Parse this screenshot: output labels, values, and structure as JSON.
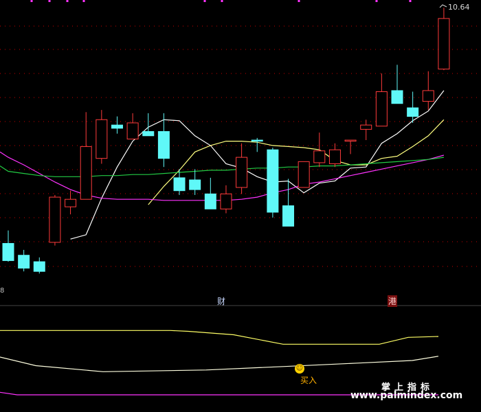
{
  "chart_data": {
    "type": "candlestick",
    "price_label": "10.64",
    "left_edge_label": "8",
    "markers": {
      "cai": "财",
      "gang": "港",
      "buy": "买入"
    },
    "brand": {
      "cn": "掌上指标",
      "url": "www.palmindex.com"
    },
    "colors": {
      "up": "#ff3b3b",
      "down": "#5ff8f8",
      "ma5": "#ffffff",
      "ma10": "#ffff80",
      "ma20": "#ff33ff",
      "ma60": "#22cc44",
      "grid": "#cc0000",
      "ind_yellow": "#ffff66",
      "ind_white": "#ffffe0",
      "ind_magenta": "#ff33ff"
    },
    "price_axis_range": [
      8.0,
      10.68
    ],
    "candles": [
      {
        "o": 8.45,
        "h": 8.57,
        "l": 8.28,
        "c": 8.29
      },
      {
        "o": 8.34,
        "h": 8.39,
        "l": 8.19,
        "c": 8.22
      },
      {
        "o": 8.28,
        "h": 8.32,
        "l": 8.17,
        "c": 8.19
      },
      {
        "o": 8.46,
        "h": 8.9,
        "l": 8.43,
        "c": 8.88
      },
      {
        "o": 8.79,
        "h": 8.94,
        "l": 8.72,
        "c": 8.86
      },
      {
        "o": 8.86,
        "h": 9.67,
        "l": 8.86,
        "c": 9.35
      },
      {
        "o": 9.24,
        "h": 9.69,
        "l": 9.19,
        "c": 9.6
      },
      {
        "o": 9.55,
        "h": 9.63,
        "l": 9.47,
        "c": 9.52
      },
      {
        "o": 9.42,
        "h": 9.66,
        "l": 9.42,
        "c": 9.57
      },
      {
        "o": 9.49,
        "h": 9.66,
        "l": 9.46,
        "c": 9.45
      },
      {
        "o": 9.49,
        "h": 9.66,
        "l": 9.16,
        "c": 9.24
      },
      {
        "o": 9.06,
        "h": 9.14,
        "l": 8.9,
        "c": 8.94
      },
      {
        "o": 9.04,
        "h": 9.14,
        "l": 8.9,
        "c": 8.95
      },
      {
        "o": 8.91,
        "h": 9.06,
        "l": 8.78,
        "c": 8.77
      },
      {
        "o": 8.77,
        "h": 8.99,
        "l": 8.73,
        "c": 8.91
      },
      {
        "o": 8.97,
        "h": 9.38,
        "l": 8.91,
        "c": 9.25
      },
      {
        "o": 9.41,
        "h": 9.43,
        "l": 9.3,
        "c": 9.4
      },
      {
        "o": 9.32,
        "h": 9.34,
        "l": 8.69,
        "c": 8.74
      },
      {
        "o": 8.8,
        "h": 9.05,
        "l": 8.61,
        "c": 8.61
      },
      {
        "o": 8.97,
        "h": 9.17,
        "l": 8.97,
        "c": 9.21
      },
      {
        "o": 9.2,
        "h": 9.48,
        "l": 9.16,
        "c": 9.31
      },
      {
        "o": 9.19,
        "h": 9.38,
        "l": 9.16,
        "c": 9.32
      },
      {
        "o": 9.4,
        "h": 9.41,
        "l": 9.28,
        "c": 9.41
      },
      {
        "o": 9.51,
        "h": 9.6,
        "l": 9.41,
        "c": 9.55
      },
      {
        "o": 9.54,
        "h": 10.03,
        "l": 9.54,
        "c": 9.86
      },
      {
        "o": 9.87,
        "h": 10.11,
        "l": 9.78,
        "c": 9.75
      },
      {
        "o": 9.71,
        "h": 9.86,
        "l": 9.57,
        "c": 9.63
      },
      {
        "o": 9.77,
        "h": 10.05,
        "l": 9.69,
        "c": 9.87
      },
      {
        "o": 10.07,
        "h": 10.64,
        "l": 10.06,
        "c": 10.54
      }
    ],
    "ma_series": [
      {
        "key": "ma5",
        "values": [
          null,
          null,
          null,
          null,
          8.49,
          8.53,
          8.87,
          9.16,
          9.4,
          9.53,
          9.6,
          9.59,
          9.45,
          9.36,
          9.19,
          9.15,
          9.07,
          9.02,
          9.03,
          8.92,
          9.01,
          9.03,
          9.15,
          9.16,
          9.38,
          9.47,
          9.59,
          9.68,
          9.87
        ]
      },
      {
        "key": "ma10",
        "values": [
          null,
          null,
          null,
          null,
          null,
          null,
          null,
          null,
          null,
          8.81,
          8.98,
          9.13,
          9.3,
          9.36,
          9.4,
          9.4,
          9.39,
          9.36,
          9.35,
          9.34,
          9.32,
          9.22,
          9.18,
          9.18,
          9.24,
          9.26,
          9.35,
          9.45,
          9.6
        ]
      },
      {
        "key": "ma20",
        "values": [
          9.25,
          9.18,
          9.1,
          9.02,
          8.95,
          8.9,
          8.87,
          8.86,
          8.86,
          8.86,
          8.85,
          8.85,
          8.85,
          8.85,
          8.85,
          8.86,
          8.88,
          8.92,
          8.95,
          9.0,
          9.02,
          9.05,
          9.08,
          9.11,
          9.14,
          9.17,
          9.2,
          9.23,
          9.27
        ]
      },
      {
        "key": "ma60",
        "values": [
          9.12,
          9.1,
          9.08,
          9.07,
          9.07,
          9.07,
          9.08,
          9.08,
          9.09,
          9.09,
          9.1,
          9.11,
          9.12,
          9.13,
          9.13,
          9.14,
          9.15,
          9.15,
          9.16,
          9.16,
          9.17,
          9.17,
          9.18,
          9.19,
          9.2,
          9.21,
          9.22,
          9.23,
          9.25
        ]
      }
    ],
    "indicator_range": [
      0,
      100
    ],
    "indicator_series": [
      {
        "key": "ind_yellow",
        "x": [
          0,
          248,
          274,
          340,
          412,
          552,
          594,
          638
        ],
        "y": [
          75,
          75,
          74,
          70,
          59,
          59,
          67,
          68
        ]
      },
      {
        "key": "ind_white",
        "x": [
          0,
          52,
          150,
          300,
          412,
          520,
          600,
          638
        ],
        "y": [
          44,
          34,
          27,
          29,
          33,
          37,
          40,
          45
        ]
      },
      {
        "key": "ind_magenta",
        "x": [
          0,
          25,
          638
        ],
        "y": [
          3,
          0,
          0
        ]
      }
    ]
  }
}
